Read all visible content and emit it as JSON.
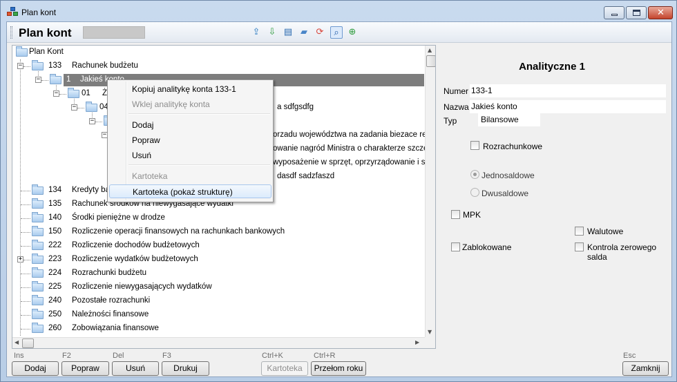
{
  "window": {
    "title": "Plan kont"
  },
  "toolbar": {
    "title": "Plan kont",
    "icons": [
      "export-icon",
      "import-icon",
      "document-list-icon",
      "folder-arrow-icon",
      "refresh-icon",
      "search-icon",
      "add-icon"
    ]
  },
  "tree": {
    "root_label": "Plan Kont",
    "rows": [
      {
        "code": "133",
        "name": "Rachunek budżetu"
      },
      {
        "code": "1",
        "name": "Jakieś konto"
      },
      {
        "code": "01",
        "name": "Ż"
      },
      {
        "code": "04",
        "name": "a sdfgsdfg"
      },
      {
        "code": "",
        "name": ""
      },
      {
        "code": "",
        "name": "orzadu województwa na zadania biezace reali"
      },
      {
        "code": "",
        "name": "owanie nagród Ministra o charakterze szczegó"
      },
      {
        "code": "",
        "name": "wyposażenie w sprzęt, oprzyrządowanie i szy"
      },
      {
        "code": "",
        "name": "dasdf sadzfaszd"
      },
      {
        "code": "134",
        "name": "Kredyty ban"
      },
      {
        "code": "135",
        "name": "Rachunek środków na niewygasające wydatki"
      },
      {
        "code": "140",
        "name": "Środki pieniężne w drodze"
      },
      {
        "code": "150",
        "name": "Rozliczenie operacji finansowych na rachunkach bankowych"
      },
      {
        "code": "222",
        "name": "Rozliczenie dochodów budżetowych"
      },
      {
        "code": "223",
        "name": "Rozliczenie wydatków budżetowych"
      },
      {
        "code": "224",
        "name": "Rozrachunki budżetu"
      },
      {
        "code": "225",
        "name": "Rozliczenie niewygasających wydatków"
      },
      {
        "code": "240",
        "name": "Pozostałe rozrachunki"
      },
      {
        "code": "250",
        "name": "Należności finansowe"
      },
      {
        "code": "260",
        "name": "Zobowiązania finansowe"
      }
    ]
  },
  "context_menu": {
    "items": [
      {
        "label": "Kopiuj analitykę konta 133-1",
        "enabled": true
      },
      {
        "label": "Wklej analitykę konta",
        "enabled": false
      },
      {
        "label": "Dodaj",
        "enabled": true
      },
      {
        "label": "Popraw",
        "enabled": true
      },
      {
        "label": "Usuń",
        "enabled": true
      },
      {
        "label": "Kartoteka",
        "enabled": false
      },
      {
        "label": "Kartoteka (pokaż strukturę)",
        "enabled": true,
        "hover": true
      }
    ]
  },
  "detail": {
    "title": "Analityczne 1",
    "numer_label": "Numer",
    "numer_value": "133-1",
    "nazwa_label": "Nazwa",
    "nazwa_value": "Jakieś konto",
    "typ_label": "Typ",
    "typ_value": "Bilansowe",
    "rozrachunkowe": "Rozrachunkowe",
    "jednosaldowe": "Jednosaldowe",
    "dwusaldowe": "Dwusaldowe",
    "mpk": "MPK",
    "walutowe": "Walutowe",
    "zablokowane": "Zablokowane",
    "kontrola": "Kontrola zerowego salda",
    "selected_saldo": "Jednosaldowe"
  },
  "footer": {
    "dodaj": {
      "key": "Ins",
      "label": "Dodaj"
    },
    "popraw": {
      "key": "F2",
      "label": "Popraw"
    },
    "usun": {
      "key": "Del",
      "label": "Usuń"
    },
    "drukuj": {
      "key": "F3",
      "label": "Drukuj"
    },
    "kartoteka": {
      "key": "Ctrl+K",
      "label": "Kartoteka"
    },
    "przelom": {
      "key": "Ctrl+R",
      "label": "Przełom roku"
    },
    "zamknij": {
      "key": "Esc",
      "label": "Zamknij"
    }
  }
}
